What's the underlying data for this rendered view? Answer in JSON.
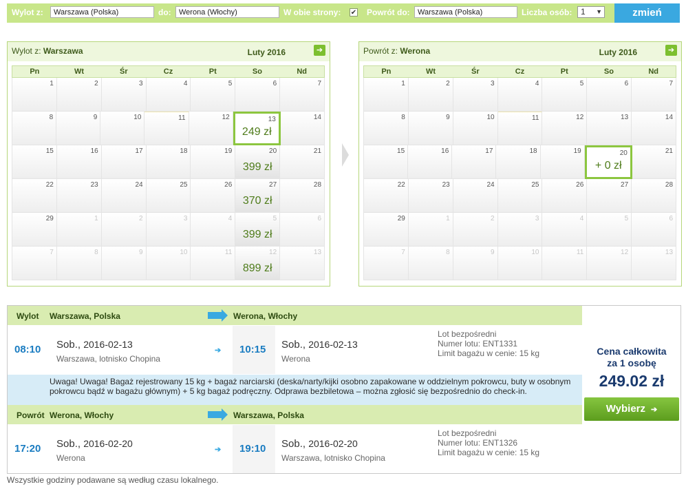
{
  "search": {
    "from_label": "Wylot z:",
    "from_value": "Warszawa (Polska)",
    "to_label": "do:",
    "to_value": "Werona (Włochy)",
    "both_label": "W obie strony:",
    "both_checked": "✔",
    "return_label": "Powrót do:",
    "return_value": "Warszawa (Polska)",
    "persons_label": "Liczba osób:",
    "persons_value": "1",
    "submit_label": "zmień"
  },
  "calendar_out": {
    "title_prefix": "Wylot z:",
    "title_city": "Warszawa",
    "month": "Luty 2016",
    "days": [
      "Pn",
      "Wt",
      "Śr",
      "Cz",
      "Pt",
      "So",
      "Nd"
    ],
    "weeks": [
      [
        {
          "n": "1"
        },
        {
          "n": "2"
        },
        {
          "n": "3"
        },
        {
          "n": "4"
        },
        {
          "n": "5"
        },
        {
          "n": "6"
        },
        {
          "n": "7"
        }
      ],
      [
        {
          "n": "8"
        },
        {
          "n": "9"
        },
        {
          "n": "10"
        },
        {
          "n": "11",
          "today": true
        },
        {
          "n": "12"
        },
        {
          "n": "13",
          "price": "249 zł",
          "sel": true
        },
        {
          "n": "14"
        }
      ],
      [
        {
          "n": "15"
        },
        {
          "n": "16"
        },
        {
          "n": "17"
        },
        {
          "n": "18"
        },
        {
          "n": "19"
        },
        {
          "n": "20",
          "price": "399 zł"
        },
        {
          "n": "21"
        }
      ],
      [
        {
          "n": "22"
        },
        {
          "n": "23"
        },
        {
          "n": "24"
        },
        {
          "n": "25"
        },
        {
          "n": "26"
        },
        {
          "n": "27",
          "price": "370 zł"
        },
        {
          "n": "28"
        }
      ],
      [
        {
          "n": "29"
        },
        {
          "n": "1",
          "o": true
        },
        {
          "n": "2",
          "o": true
        },
        {
          "n": "3",
          "o": true
        },
        {
          "n": "4",
          "o": true
        },
        {
          "n": "5",
          "o": true,
          "price": "399 zł"
        },
        {
          "n": "6",
          "o": true
        }
      ],
      [
        {
          "n": "7",
          "o": true
        },
        {
          "n": "8",
          "o": true
        },
        {
          "n": "9",
          "o": true
        },
        {
          "n": "10",
          "o": true
        },
        {
          "n": "11",
          "o": true
        },
        {
          "n": "12",
          "o": true,
          "price": "899 zł"
        },
        {
          "n": "13",
          "o": true
        }
      ]
    ]
  },
  "calendar_ret": {
    "title_prefix": "Powrót z:",
    "title_city": "Werona",
    "month": "Luty 2016",
    "days": [
      "Pn",
      "Wt",
      "Śr",
      "Cz",
      "Pt",
      "So",
      "Nd"
    ],
    "weeks": [
      [
        {
          "n": "1"
        },
        {
          "n": "2"
        },
        {
          "n": "3"
        },
        {
          "n": "4"
        },
        {
          "n": "5"
        },
        {
          "n": "6"
        },
        {
          "n": "7"
        }
      ],
      [
        {
          "n": "8"
        },
        {
          "n": "9"
        },
        {
          "n": "10"
        },
        {
          "n": "11",
          "today": true
        },
        {
          "n": "12"
        },
        {
          "n": "13"
        },
        {
          "n": "14"
        }
      ],
      [
        {
          "n": "15"
        },
        {
          "n": "16"
        },
        {
          "n": "17"
        },
        {
          "n": "18"
        },
        {
          "n": "19"
        },
        {
          "n": "20",
          "price": "+ 0 zł",
          "sel": true
        },
        {
          "n": "21"
        }
      ],
      [
        {
          "n": "22"
        },
        {
          "n": "23"
        },
        {
          "n": "24"
        },
        {
          "n": "25"
        },
        {
          "n": "26"
        },
        {
          "n": "27"
        },
        {
          "n": "28"
        }
      ],
      [
        {
          "n": "29"
        },
        {
          "n": "1",
          "o": true
        },
        {
          "n": "2",
          "o": true
        },
        {
          "n": "3",
          "o": true
        },
        {
          "n": "4",
          "o": true
        },
        {
          "n": "5",
          "o": true
        },
        {
          "n": "6",
          "o": true
        }
      ],
      [
        {
          "n": "7",
          "o": true
        },
        {
          "n": "8",
          "o": true
        },
        {
          "n": "9",
          "o": true
        },
        {
          "n": "10",
          "o": true
        },
        {
          "n": "11",
          "o": true
        },
        {
          "n": "12",
          "o": true
        },
        {
          "n": "13",
          "o": true
        }
      ]
    ]
  },
  "outbound": {
    "label": "Wylot",
    "from_city": "Warszawa, Polska",
    "to_city": "Werona, Włochy",
    "dep_time": "08:10",
    "dep_day": "Sob.,",
    "dep_date": "2016-02-13",
    "dep_place": "Warszawa, lotnisko Chopina",
    "arr_time": "10:15",
    "arr_day": "Sob.,",
    "arr_date": "2016-02-13",
    "arr_place": "Werona",
    "info1": "Lot bezpośredni",
    "info2": "Numer lotu: ENT1331",
    "info3": "Limit bagażu w cenie: 15 kg"
  },
  "warning": "Uwaga! Uwaga! Bagaż rejestrowany 15 kg + bagaż narciarski (deska/narty/kijki osobno zapakowane w oddzielnym pokrowcu, buty w osobnym pokrowcu bądź w bagażu głównym) + 5 kg bagaż podręczny. Odprawa bezbiletowa – można zgłosić się bezpośrednio do check-in.",
  "inbound": {
    "label": "Powrót",
    "from_city": "Werona, Włochy",
    "to_city": "Warszawa, Polska",
    "dep_time": "17:20",
    "dep_day": "Sob.,",
    "dep_date": "2016-02-20",
    "dep_place": "Werona",
    "arr_time": "19:10",
    "arr_day": "Sob.,",
    "arr_date": "2016-02-20",
    "arr_place": "Warszawa, lotnisko Chopina",
    "info1": "Lot bezpośredni",
    "info2": "Numer lotu: ENT1326",
    "info3": "Limit bagażu w cenie: 15 kg"
  },
  "price": {
    "label_line1": "Cena całkowita",
    "label_line2": "za 1 osobę",
    "total": "249.02 zł",
    "button": "Wybierz",
    "button_icon": "➔"
  },
  "footnote": "Wszystkie godziny podawane są według czasu lokalnego.",
  "arrow_glyph": "➔"
}
